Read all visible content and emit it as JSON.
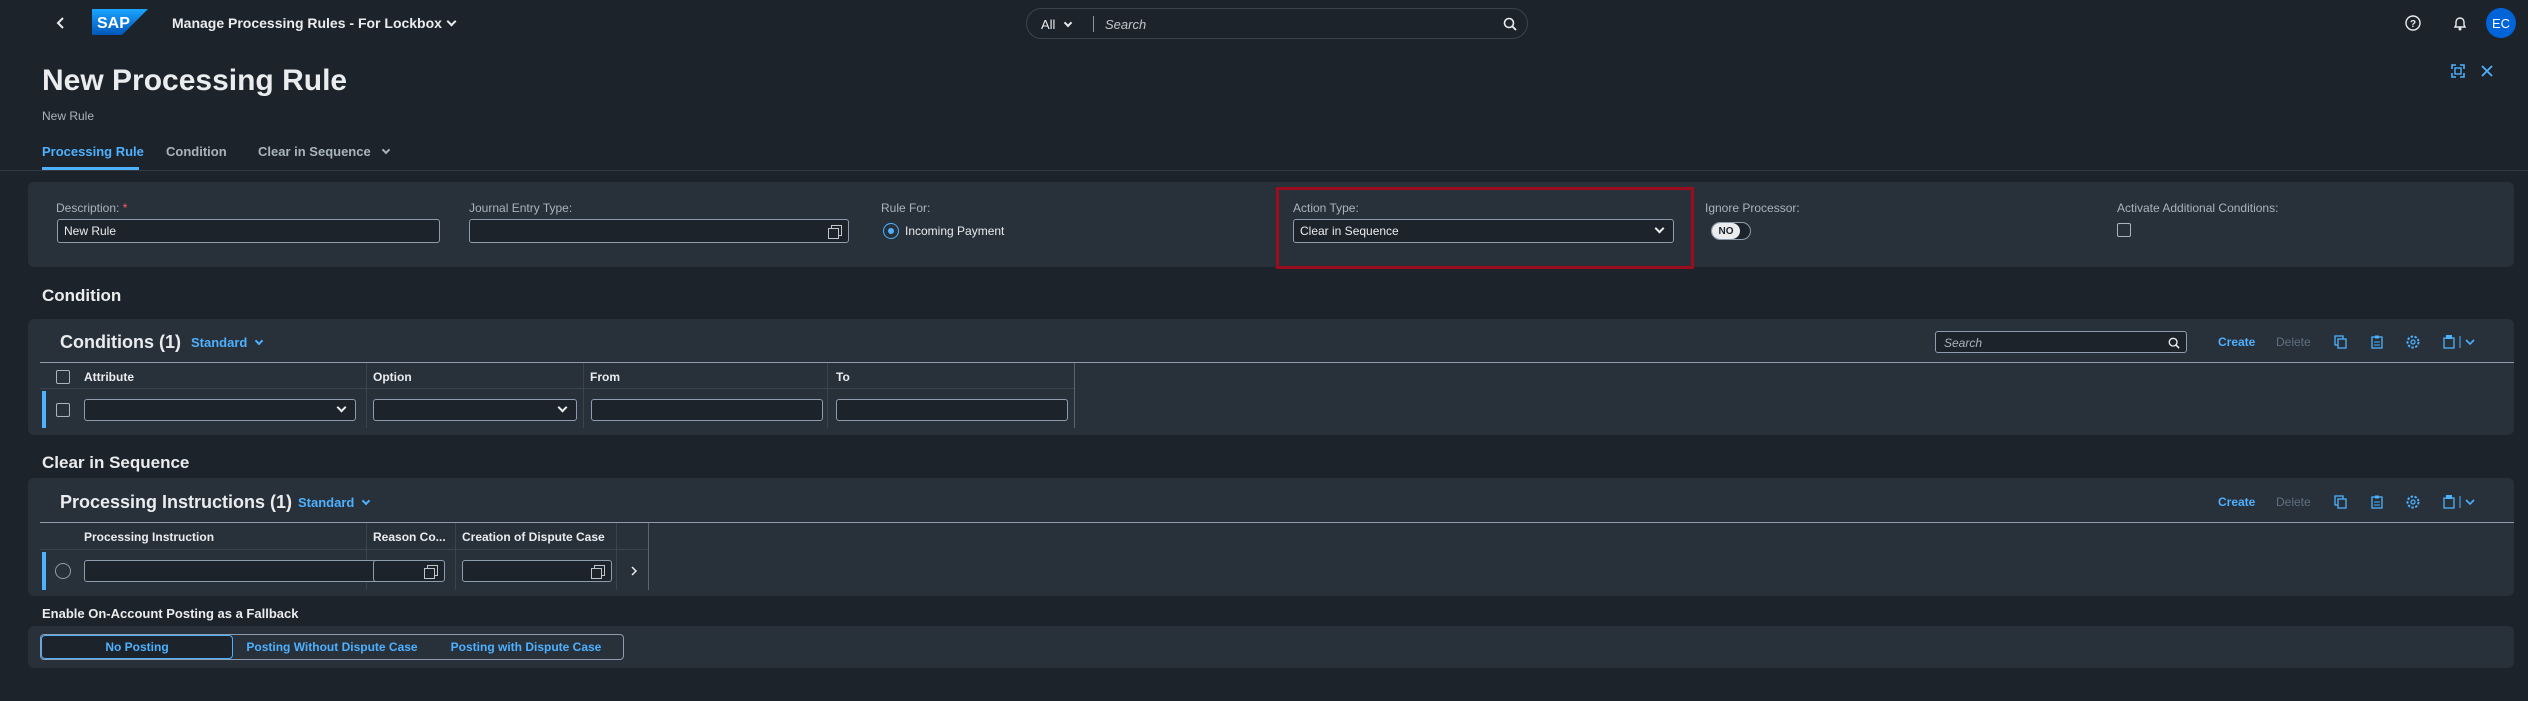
{
  "shell": {
    "logo_text": "SAP",
    "app_title": "Manage Processing Rules - For Lockbox",
    "search_scope": "All",
    "search_placeholder": "Search",
    "avatar_initials": "EC",
    "brand_color": "#0a6ed1"
  },
  "header": {
    "title": "New Processing Rule",
    "subtitle": "New Rule",
    "tabs": [
      {
        "label": "Processing Rule",
        "active": true
      },
      {
        "label": "Condition",
        "active": false
      },
      {
        "label": "Clear in Sequence",
        "active": false
      }
    ]
  },
  "rule_form": {
    "description_label": "Description:",
    "description_required_mark": "*",
    "description_value": "New Rule",
    "journal_entry_type_label": "Journal Entry Type:",
    "journal_entry_type_value": "",
    "rule_for_label": "Rule For:",
    "rule_for_option": "Incoming Payment",
    "action_type_label": "Action Type:",
    "action_type_value": "Clear in Sequence",
    "ignore_processor_label": "Ignore Processor:",
    "ignore_processor_value": "NO",
    "activate_conditions_label": "Activate Additional Conditions:",
    "activate_conditions_checked": false
  },
  "condition_section": {
    "title": "Condition",
    "table_title": "Conditions (1)",
    "variant": "Standard",
    "search_placeholder": "Search",
    "create_label": "Create",
    "delete_label": "Delete",
    "columns": [
      "Attribute",
      "Option",
      "From",
      "To"
    ],
    "rows": [
      {
        "attribute": "",
        "option": "",
        "from": "",
        "to": ""
      }
    ]
  },
  "sequence_section": {
    "title": "Clear in Sequence",
    "table_title": "Processing Instructions (1)",
    "variant": "Standard",
    "create_label": "Create",
    "delete_label": "Delete",
    "columns": [
      "Processing Instruction",
      "Reason Co...",
      "Creation of Dispute Case"
    ],
    "rows": [
      {
        "processing_instruction": "",
        "reason_code": "",
        "dispute_case": ""
      }
    ]
  },
  "fallback": {
    "title": "Enable On-Account Posting as a Fallback",
    "options": [
      "No Posting",
      "Posting Without Dispute Case",
      "Posting with Dispute Case"
    ],
    "selected": "No Posting"
  },
  "colors": {
    "accent": "#4db1ff",
    "background": "#1d232a",
    "panel": "#28303a",
    "highlight_border": "#9c0c1f",
    "avatar": "#0064d9"
  }
}
